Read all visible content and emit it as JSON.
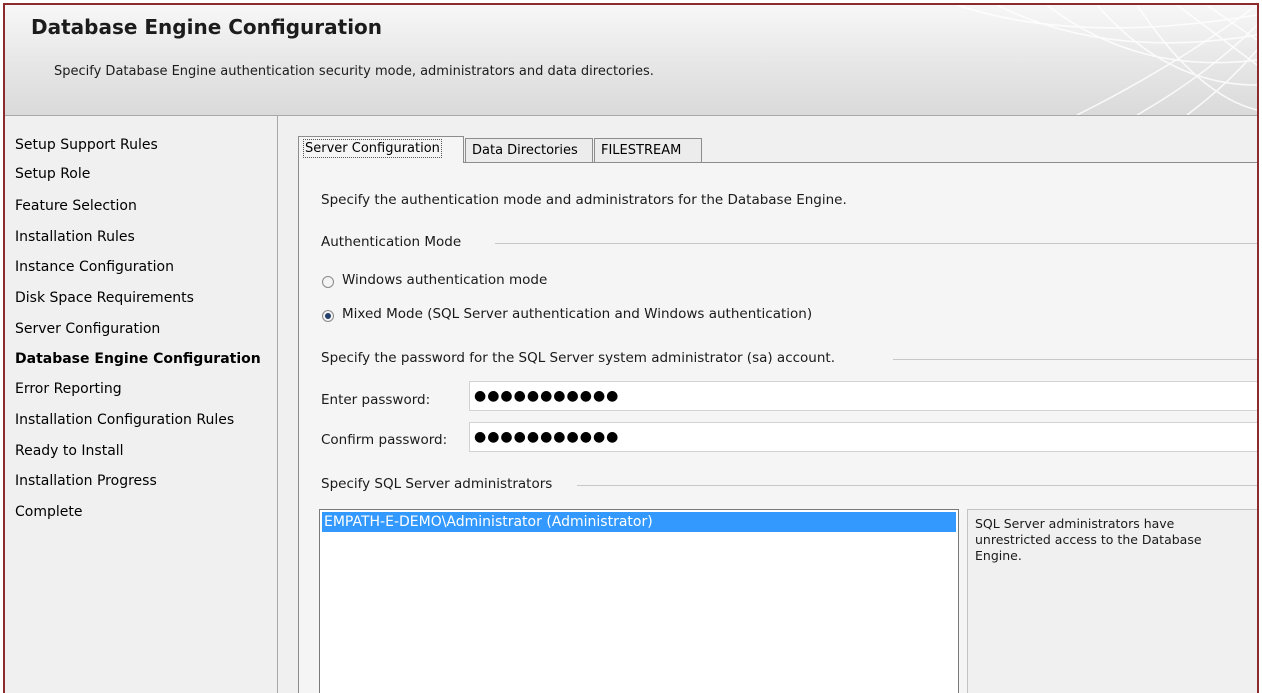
{
  "header": {
    "title": "Database Engine Configuration",
    "subtitle": "Specify Database Engine authentication security mode, administrators and data directories."
  },
  "nav": {
    "items": [
      {
        "label": "Setup Support Rules"
      },
      {
        "label": "Setup Role"
      },
      {
        "label": "Feature Selection"
      },
      {
        "label": "Installation Rules"
      },
      {
        "label": "Instance Configuration"
      },
      {
        "label": "Disk Space Requirements"
      },
      {
        "label": "Server Configuration"
      },
      {
        "label": "Database Engine Configuration"
      },
      {
        "label": "Error Reporting"
      },
      {
        "label": "Installation Configuration Rules"
      },
      {
        "label": "Ready to Install"
      },
      {
        "label": "Installation Progress"
      },
      {
        "label": "Complete"
      }
    ],
    "active": "Database Engine Configuration"
  },
  "tabs": [
    {
      "label": "Server Configuration"
    },
    {
      "label": "Data Directories"
    },
    {
      "label": "FILESTREAM"
    }
  ],
  "active_tab": "Server Configuration",
  "server_config": {
    "intro": "Specify the authentication mode and administrators for the Database Engine.",
    "auth_group_label": "Authentication Mode",
    "auth_windows_label": "Windows authentication mode",
    "auth_mixed_label": "Mixed Mode (SQL Server authentication and Windows authentication)",
    "auth_selected": "mixed",
    "sa_group_label": "Specify the password for the SQL Server system administrator (sa) account.",
    "enter_password_label": "Enter password:",
    "enter_password_value": "●●●●●●●●●●●",
    "confirm_password_label": "Confirm password:",
    "confirm_password_value": "●●●●●●●●●●●",
    "admins_group_label": "Specify SQL Server administrators",
    "admins": [
      "EMPATH-E-DEMO\\Administrator (Administrator)"
    ],
    "admins_info": "SQL Server administrators have unrestricted access to the Database Engine."
  },
  "colors": {
    "frame_border": "#8b2b2b",
    "selection": "#3399ff",
    "background": "#f0f0f0"
  }
}
